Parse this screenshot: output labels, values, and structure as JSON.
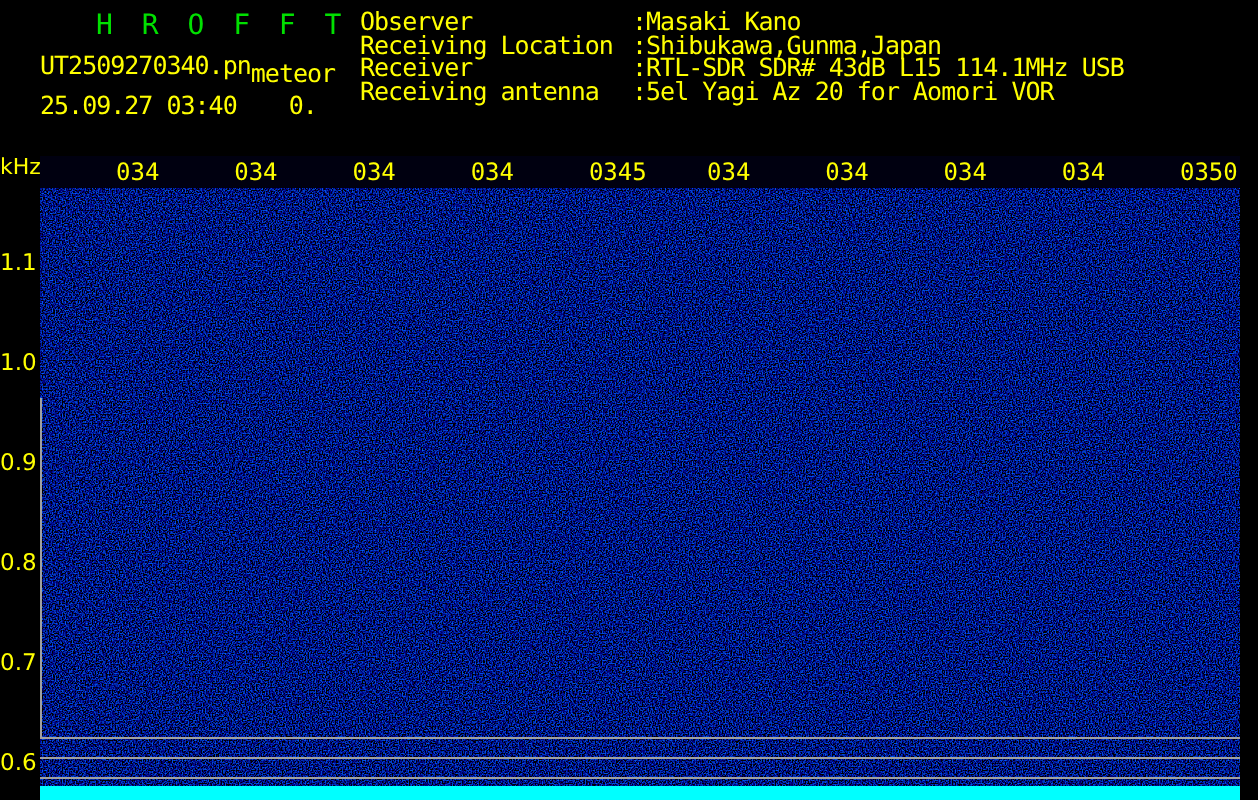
{
  "header": {
    "title": "H R O F F T",
    "file": "UT2509270340.pn",
    "tag": "meteor",
    "timestamp": "25.09.27 03:40",
    "count": "0."
  },
  "info": [
    {
      "label": "Observer",
      "value": ":Masaki Kano"
    },
    {
      "label": "Receiving Location",
      "value": ":Shibukawa,Gunma,Japan"
    },
    {
      "label": "Receiver",
      "value": ":RTL-SDR SDR# 43dB L15 114.1MHz USB"
    },
    {
      "label": "Receiving antenna",
      "value": ":5el Yagi Az 20 for Aomori VOR"
    }
  ],
  "plot": {
    "unit": "kHz",
    "time_labels": [
      "034",
      "034",
      "034",
      "034",
      "0345",
      "034",
      "034",
      "034",
      "034",
      "0350"
    ],
    "y_labels": [
      "1.1",
      "1.0",
      "0.9",
      "0.8",
      "0.7",
      "0.6"
    ]
  }
}
